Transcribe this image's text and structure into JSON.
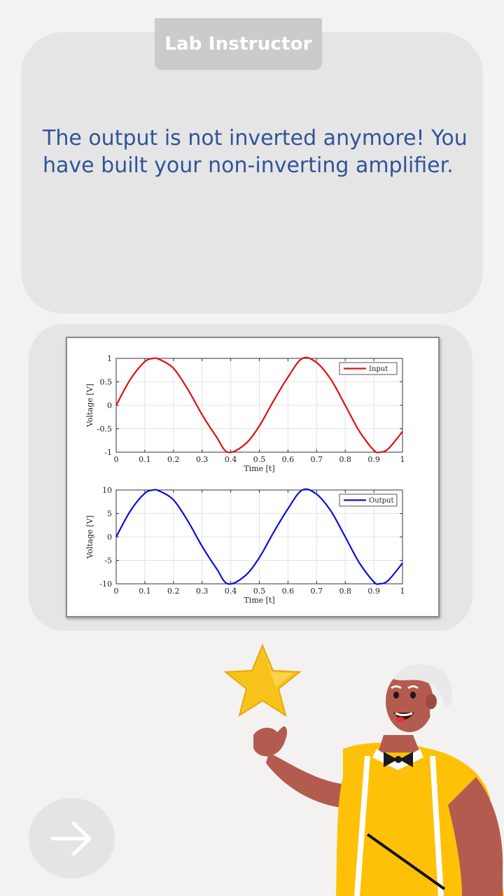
{
  "dialog": {
    "speaker": "Lab Instructor",
    "message": "The output is not inverted anymore! You have built your non-inverting amplifier."
  },
  "figure": {
    "top_plot": {
      "legend": "Input",
      "ylabel": "Voltage [V]",
      "xlabel": "Time [t]",
      "color": "#e01010"
    },
    "bottom_plot": {
      "legend": "Output",
      "ylabel": "Voltage [V]",
      "xlabel": "Time [t]",
      "color": "#0a10d8"
    }
  },
  "chart_data": [
    {
      "type": "line",
      "xlabel": "Time [t]",
      "ylabel": "Voltage [V]",
      "xlim": [
        0,
        1
      ],
      "ylim": [
        -1,
        1
      ],
      "xticks": [
        "0",
        "0.1",
        "0.2",
        "0.3",
        "0.4",
        "0.5",
        "0.6",
        "0.7",
        "0.8",
        "0.9",
        "1"
      ],
      "yticks": [
        "1",
        "0.5",
        "0",
        "-0.5",
        "-1"
      ],
      "grid": true,
      "legend_position": "top-right",
      "series": [
        {
          "name": "Input",
          "color": "#e01010",
          "x": [
            0,
            0.05,
            0.1,
            0.13,
            0.15,
            0.2,
            0.25,
            0.3,
            0.35,
            0.39,
            0.45,
            0.5,
            0.55,
            0.6,
            0.65,
            0.7,
            0.75,
            0.8,
            0.85,
            0.9,
            0.92,
            0.95,
            1
          ],
          "y": [
            0,
            0.56,
            0.93,
            1.0,
            0.98,
            0.79,
            0.34,
            -0.2,
            -0.67,
            -1.0,
            -0.83,
            -0.44,
            0.1,
            0.6,
            1.0,
            0.91,
            0.55,
            0.0,
            -0.56,
            -0.96,
            -1.0,
            -0.93,
            -0.56
          ]
        }
      ]
    },
    {
      "type": "line",
      "xlabel": "Time [t]",
      "ylabel": "Voltage [V]",
      "xlim": [
        0,
        1
      ],
      "ylim": [
        -10,
        10
      ],
      "xticks": [
        "0",
        "0.1",
        "0.2",
        "0.3",
        "0.4",
        "0.5",
        "0.6",
        "0.7",
        "0.8",
        "0.9",
        "1"
      ],
      "yticks": [
        "10",
        "5",
        "0",
        "-5",
        "-10"
      ],
      "grid": true,
      "legend_position": "top-right",
      "series": [
        {
          "name": "Output",
          "color": "#0a10d8",
          "x": [
            0,
            0.05,
            0.1,
            0.13,
            0.15,
            0.2,
            0.25,
            0.3,
            0.35,
            0.39,
            0.45,
            0.5,
            0.55,
            0.6,
            0.65,
            0.7,
            0.75,
            0.8,
            0.85,
            0.9,
            0.92,
            0.95,
            1
          ],
          "y": [
            0,
            5.6,
            9.3,
            10.0,
            9.8,
            7.9,
            3.4,
            -2.0,
            -6.7,
            -10.0,
            -8.3,
            -4.4,
            1.0,
            6.0,
            10.0,
            9.1,
            5.5,
            0.0,
            -5.6,
            -9.6,
            -10.0,
            -9.3,
            -5.6
          ]
        }
      ]
    }
  ],
  "navigation": {
    "next_icon": "arrow-right-icon",
    "button_color": "#e5e4e5"
  },
  "illustration": {
    "star_icon": "star-icon",
    "character": "instructor-character"
  }
}
